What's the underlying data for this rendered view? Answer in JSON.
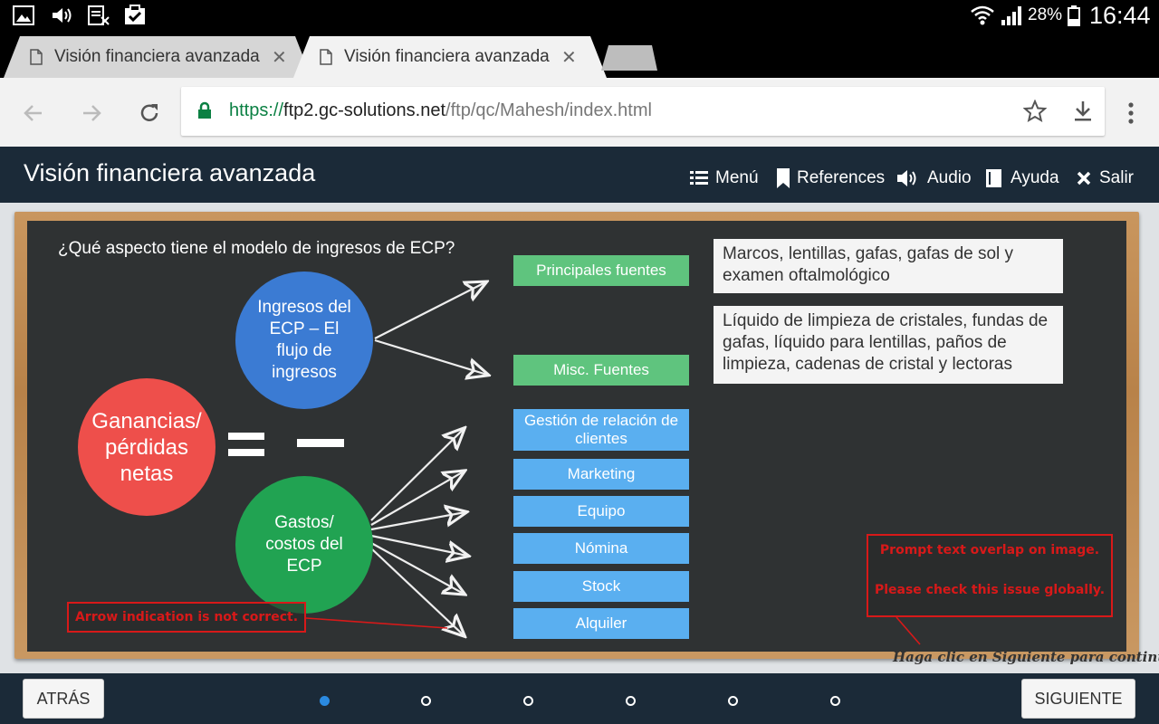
{
  "status_bar": {
    "battery_percent": "28%",
    "time": "16:44",
    "icons": [
      "image-icon",
      "volume-icon",
      "no-sim-icon",
      "clipboard-check-icon",
      "wifi-icon",
      "signal-icon",
      "battery-icon"
    ]
  },
  "browser": {
    "tabs": [
      {
        "title": "Visión financiera avanzada",
        "active": false
      },
      {
        "title": "Visión financiera avanzada",
        "active": true
      }
    ],
    "url": {
      "scheme": "https://",
      "host": "ftp2.gc-solutions.net",
      "path": "/ftp/qc/Mahesh/index.html"
    }
  },
  "course": {
    "title": "Visión financiera avanzada",
    "nav": {
      "menu": "Menú",
      "references": "References",
      "audio": "Audio",
      "help": "Ayuda",
      "exit": "Salir"
    }
  },
  "slide": {
    "question": "¿Qué aspecto tiene el modelo de ingresos de ECP?",
    "circles": {
      "net": "Ganancias/\npérdidas\nnetas",
      "income": "Ingresos del\nECP – El\nflujo de\ningresos",
      "costs": "Gastos/\ncostos del\nECP"
    },
    "income_sources": [
      "Principales fuentes",
      "Misc. Fuentes"
    ],
    "income_details": [
      "Marcos, lentillas, gafas, gafas de sol y examen oftalmológico",
      "Líquido de limpieza de cristales, fundas de gafas, líquido para lentillas, paños de limpieza, cadenas de cristal y lectoras"
    ],
    "costs": [
      "Gestión de relación de clientes",
      "Marketing",
      "Equipo",
      "Nómina",
      "Stock",
      "Alquiler"
    ],
    "qa_annotations": {
      "arrow": "Arrow indication is not correct.",
      "overlap_line1": "Prompt text overlap on image.",
      "overlap_line2": "Please check this issue globally."
    },
    "continue_hint": "Haga clic en Siguiente para continuar."
  },
  "footer": {
    "back": "ATRÁS",
    "next": "SIGUIENTE",
    "page_count": 6,
    "current_page": 1
  },
  "colors": {
    "net_circle": "#ee4f4b",
    "income_circle": "#3b7bd3",
    "costs_circle": "#21a352",
    "green_box": "#5fc47e",
    "blue_box": "#5aaff0",
    "header_bg": "#1b2a38",
    "annotation_red": "#d81919"
  }
}
